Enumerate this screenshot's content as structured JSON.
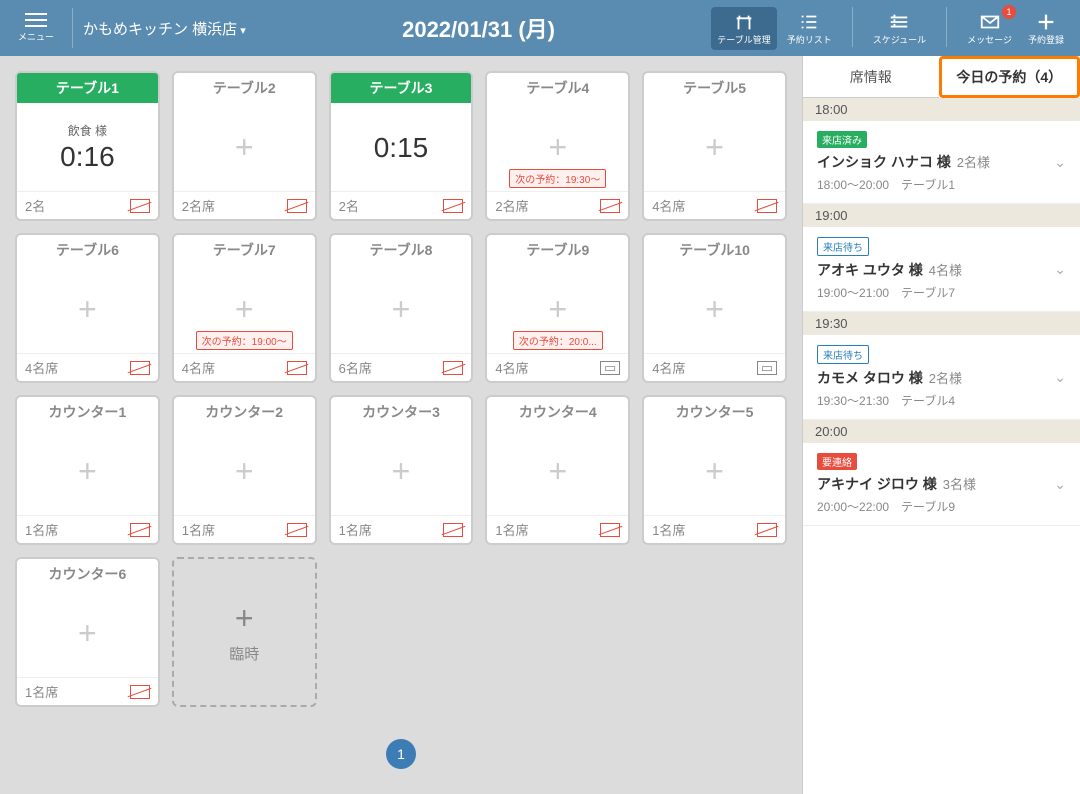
{
  "header": {
    "menu": "メニュー",
    "store": "かもめキッチン 横浜店",
    "date": "2022/01/31 (月)",
    "nav": [
      {
        "label": "テーブル管理"
      },
      {
        "label": "予約リスト"
      },
      {
        "label": "スケジュール"
      },
      {
        "label": "メッセージ",
        "badge": "1"
      },
      {
        "label": "予約登録"
      }
    ]
  },
  "tables": [
    {
      "name": "テーブル1",
      "occ": true,
      "guest": "飲食 様",
      "timer": "0:16",
      "foot": "2名",
      "smoke": "no"
    },
    {
      "name": "テーブル2",
      "foot": "2名席",
      "smoke": "no"
    },
    {
      "name": "テーブル3",
      "occ": true,
      "timer": "0:15",
      "foot": "2名",
      "smoke": "no"
    },
    {
      "name": "テーブル4",
      "next": "次の予約：19:30～",
      "foot": "2名席",
      "smoke": "no"
    },
    {
      "name": "テーブル5",
      "foot": "4名席",
      "smoke": "no"
    },
    {
      "name": "テーブル6",
      "foot": "4名席",
      "smoke": "no"
    },
    {
      "name": "テーブル7",
      "next": "次の予約：19:00～",
      "foot": "4名席",
      "smoke": "no"
    },
    {
      "name": "テーブル8",
      "foot": "6名席",
      "smoke": "no"
    },
    {
      "name": "テーブル9",
      "next": "次の予約：20:0...",
      "foot": "4名席",
      "smoke": "sep"
    },
    {
      "name": "テーブル10",
      "foot": "4名席",
      "smoke": "sep"
    },
    {
      "name": "カウンター1",
      "foot": "1名席",
      "smoke": "no"
    },
    {
      "name": "カウンター2",
      "foot": "1名席",
      "smoke": "no"
    },
    {
      "name": "カウンター3",
      "foot": "1名席",
      "smoke": "no"
    },
    {
      "name": "カウンター4",
      "foot": "1名席",
      "smoke": "no"
    },
    {
      "name": "カウンター5",
      "foot": "1名席",
      "smoke": "no"
    },
    {
      "name": "カウンター6",
      "foot": "1名席",
      "smoke": "no"
    }
  ],
  "temp_label": "臨時",
  "page": "1",
  "side": {
    "tab1": "席情報",
    "tab2": "今日の予約（4）",
    "groups": [
      {
        "time": "18:00",
        "res": [
          {
            "status": "来店済み",
            "cls": "st-green",
            "name": "インショク ハナコ 様",
            "cnt": "2名様",
            "detail": "18:00～20:00　テーブル1"
          }
        ]
      },
      {
        "time": "19:00",
        "res": [
          {
            "status": "来店待ち",
            "cls": "st-blue",
            "name": "アオキ ユウタ 様",
            "cnt": "4名様",
            "detail": "19:00～21:00　テーブル7"
          }
        ]
      },
      {
        "time": "19:30",
        "res": [
          {
            "status": "来店待ち",
            "cls": "st-blue",
            "name": "カモメ タロウ 様",
            "cnt": "2名様",
            "detail": "19:30～21:30　テーブル4"
          }
        ]
      },
      {
        "time": "20:00",
        "res": [
          {
            "status": "要連絡",
            "cls": "st-red",
            "name": "アキナイ ジロウ 様",
            "cnt": "3名様",
            "detail": "20:00～22:00　テーブル9"
          }
        ]
      }
    ]
  }
}
